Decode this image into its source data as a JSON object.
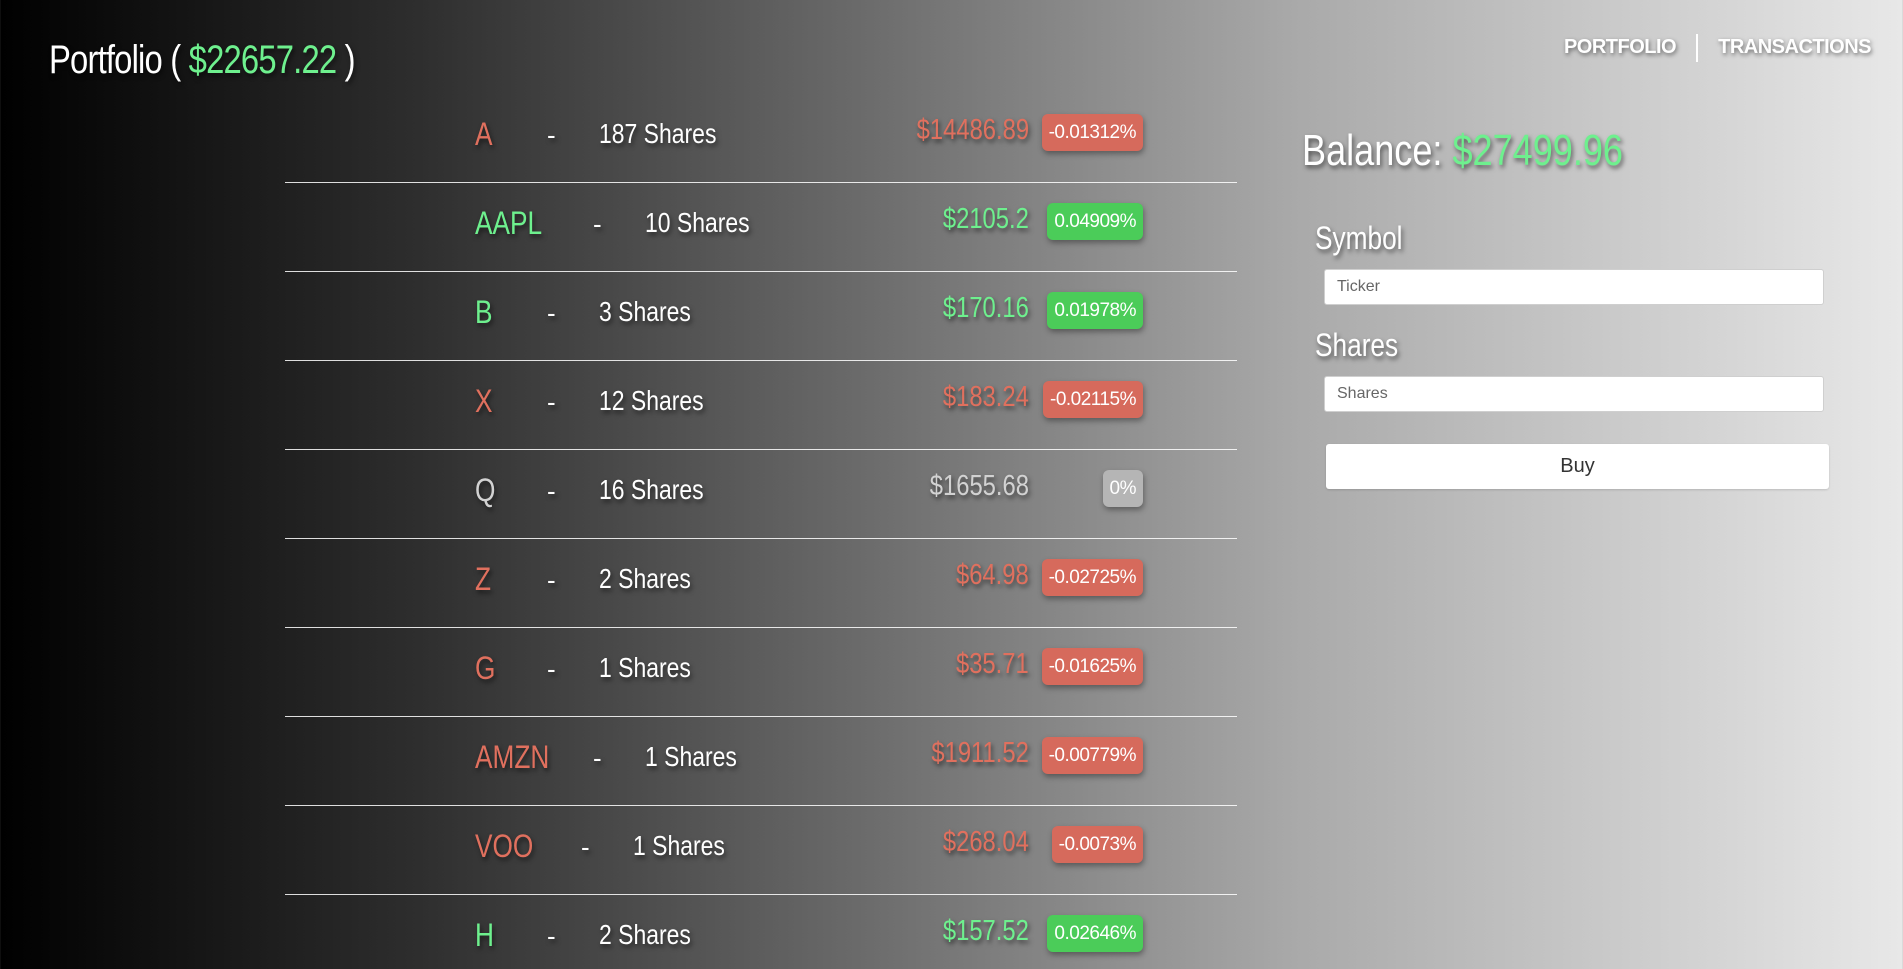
{
  "header": {
    "title_prefix": "Portfolio ( ",
    "portfolio_value": "$22657.22",
    "title_suffix": " )"
  },
  "nav": {
    "portfolio": "PORTFOLIO",
    "transactions": "TRANSACTIONS"
  },
  "holdings": [
    {
      "symbol": "A",
      "shares": "187 Shares",
      "price": "$14486.89",
      "change": "-0.01312%",
      "trend": "down"
    },
    {
      "symbol": "AAPL",
      "shares": "10 Shares",
      "price": "$2105.2",
      "change": "0.04909%",
      "trend": "up"
    },
    {
      "symbol": "B",
      "shares": "3 Shares",
      "price": "$170.16",
      "change": "0.01978%",
      "trend": "up"
    },
    {
      "symbol": "X",
      "shares": "12 Shares",
      "price": "$183.24",
      "change": "-0.02115%",
      "trend": "down"
    },
    {
      "symbol": "Q",
      "shares": "16 Shares",
      "price": "$1655.68",
      "change": "0%",
      "trend": "flat"
    },
    {
      "symbol": "Z",
      "shares": "2 Shares",
      "price": "$64.98",
      "change": "-0.02725%",
      "trend": "down"
    },
    {
      "symbol": "G",
      "shares": "1 Shares",
      "price": "$35.71",
      "change": "-0.01625%",
      "trend": "down"
    },
    {
      "symbol": "AMZN",
      "shares": "1 Shares",
      "price": "$1911.52",
      "change": "-0.00779%",
      "trend": "down"
    },
    {
      "symbol": "VOO",
      "shares": "1 Shares",
      "price": "$268.04",
      "change": "-0.0073%",
      "trend": "down"
    },
    {
      "symbol": "H",
      "shares": "2 Shares",
      "price": "$157.52",
      "change": "0.02646%",
      "trend": "up"
    }
  ],
  "separator": "-",
  "balance": {
    "label": "Balance: ",
    "value": "$27499.96"
  },
  "form": {
    "symbol_label": "Symbol",
    "symbol_placeholder": "Ticker",
    "shares_label": "Shares",
    "shares_placeholder": "Shares",
    "buy_label": "Buy"
  },
  "colors": {
    "positive": "#6ef08e",
    "negative": "#e0705e",
    "neutral": "#d2d2d2",
    "badge_up": "#4bcc59",
    "badge_down": "#d66a5c",
    "badge_flat": "#b5b5b5"
  }
}
